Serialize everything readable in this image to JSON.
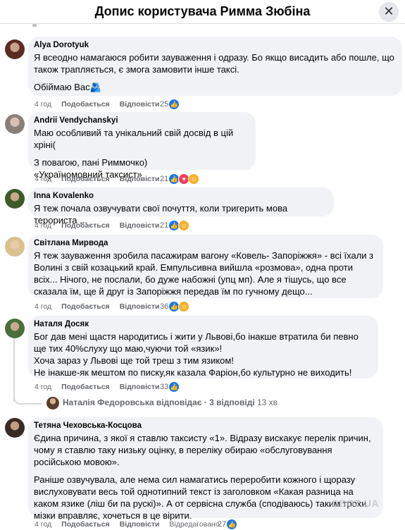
{
  "header": {
    "title": "Допис користувача Римма Зюбіна",
    "close_icon": "close-icon"
  },
  "comments": [
    {
      "author": "Alya Dorotyuk",
      "text": [
        "Я всеодно намагаюся робити зауваження і одразу. Бо якщо висадить або пошле, що також трапляється, є змога замовити інше таксі.",
        "Обіймаю Вас🫂"
      ],
      "time": "4 год",
      "like": "Подобається",
      "reply": "Відповісти",
      "reactions_count": "25",
      "reactions": [
        "like"
      ]
    },
    {
      "author": "Andrii Vendychanskyi",
      "text": [
        "Маю особливий та унікальний свій досвід в цій хріні(",
        "З повагою, пані Риммочко)",
        "«Україномовний таксист»"
      ],
      "time": "4 год",
      "like": "Подобається",
      "reply": "Відповісти",
      "reactions_count": "21",
      "reactions": [
        "like",
        "love",
        "care"
      ]
    },
    {
      "author": "Inna Kovalenko",
      "text": [
        "Я теж почала озвучувати свої почуття, коли тригерить мова терориста ..."
      ],
      "time": "4 год",
      "like": "Подобається",
      "reply": "Відповісти",
      "reactions_count": "21",
      "reactions": [
        "like",
        "care"
      ]
    },
    {
      "author": "Світлана Мирвода",
      "text": [
        "Я теж зауваження зробила пасажирам вагону «Ковель- Запоріжжя» - всі їхали з Волині з свій козацький край. Емпульсивна вийшла «розмова», одна проти всіх... Нічого, не послали, бо дуже набожні (упц мп). Але я тішусь, що все сказала їм, ще й друг із Запоріжжя передав їм по гучному дещо..."
      ],
      "time": "4 год",
      "like": "Подобається",
      "reply": "Відповісти",
      "reactions_count": "36",
      "reactions": [
        "like",
        "care"
      ]
    },
    {
      "author": "Наталя Досяк",
      "text": [
        "Бог дав мені щастя народитись і жити у Львові,бо інакше втратила би певно ще тих 40%слуху що маю,чуючи той «язик»!",
        "Хоча зараз у Львові ще той треш з тим язиком!",
        "Не інакше-як мештом по писку,як казала Фаріон,бо культурно не виходить!"
      ],
      "time": "4 год",
      "like": "Подобається",
      "reply": "Відповісти",
      "reactions_count": "33",
      "reactions": [
        "like"
      ]
    },
    {
      "author": "Тетяна Чеховська-Косцова",
      "text": [
        "Єдина причина, з якої я ставлю таксисту «1». Відразу вискакує перелік причин, чому я ставлю таку низьку оцінку, в переліку обираю «обслуговування російською мовою».",
        "Раніше озвучувала, але нема сил намагатись переробити кожного і щоразу вислуховувати весь той однотипний текст із заголовком «Какая разница на каком язике (ліш би па рускі)». А от сервісна служба (сподіваюсь) таким трохи мізки вправляє, хочеться в це вірити."
      ],
      "time": "4 год",
      "like": "Подобається",
      "reply": "Відповісти",
      "edited": "Відредаговано",
      "reactions_count": "27",
      "reactions": [
        "like"
      ]
    }
  ],
  "replies_row": {
    "name": "Наталія Федоровська",
    "action": "відповідає",
    "count": "· 3 відповіді",
    "time": "13 хв"
  },
  "watermark": "OBOZ.UA",
  "colors": {
    "like": "#1877f2",
    "love": "#f33e58",
    "care": "#f7b125",
    "bubble": "#f0f2f5"
  }
}
